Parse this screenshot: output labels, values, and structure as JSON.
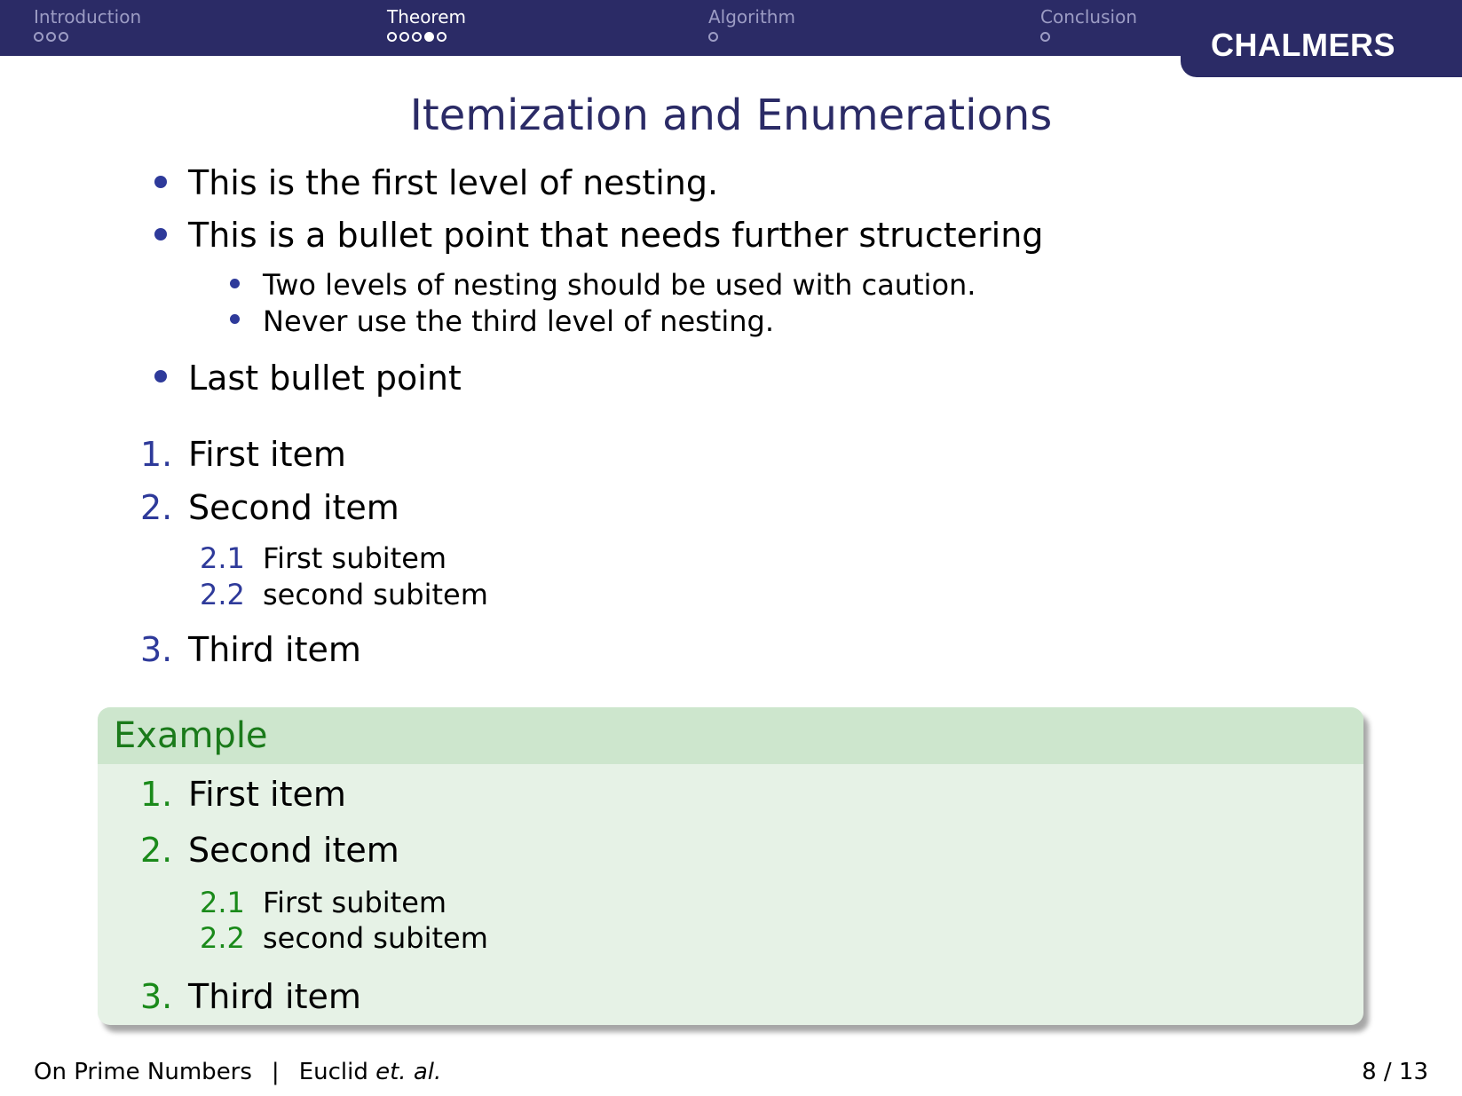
{
  "header": {
    "logo": "CHALMERS",
    "sections": [
      {
        "label": "Introduction",
        "dots": 3,
        "filled": -1
      },
      {
        "label": "Theorem",
        "dots": 5,
        "filled": 3
      },
      {
        "label": "Algorithm",
        "dots": 1,
        "filled": -1
      },
      {
        "label": "Conclusion",
        "dots": 1,
        "filled": -1
      }
    ]
  },
  "slide": {
    "title": "Itemization and Enumerations",
    "bullets": [
      "This is the first level of nesting.",
      "This is a bullet point that needs further structering",
      "Two levels of nesting should be used with caution.",
      "Never use the third level of nesting.",
      "Last bullet point"
    ],
    "enum": [
      {
        "num": "1.",
        "text": "First item"
      },
      {
        "num": "2.",
        "text": "Second item"
      },
      {
        "num": "2.1",
        "text": "First subitem"
      },
      {
        "num": "2.2",
        "text": "second subitem"
      },
      {
        "num": "3.",
        "text": "Third item"
      }
    ],
    "example": {
      "title": "Example",
      "items": [
        {
          "num": "1.",
          "text": "First item"
        },
        {
          "num": "2.",
          "text": "Second item"
        },
        {
          "num": "2.1",
          "text": "First subitem"
        },
        {
          "num": "2.2",
          "text": "second subitem"
        },
        {
          "num": "3.",
          "text": "Third item"
        }
      ]
    }
  },
  "footer": {
    "title": "On Prime Numbers",
    "separator": "|",
    "author": "Euclid",
    "author_suffix": "et. al.",
    "page": "8 / 13"
  },
  "colors": {
    "header_bg": "#2b2b66",
    "structure": "#2e3a9a",
    "example_green": "#1a8a1a",
    "example_bg": "#e6f2e6"
  }
}
